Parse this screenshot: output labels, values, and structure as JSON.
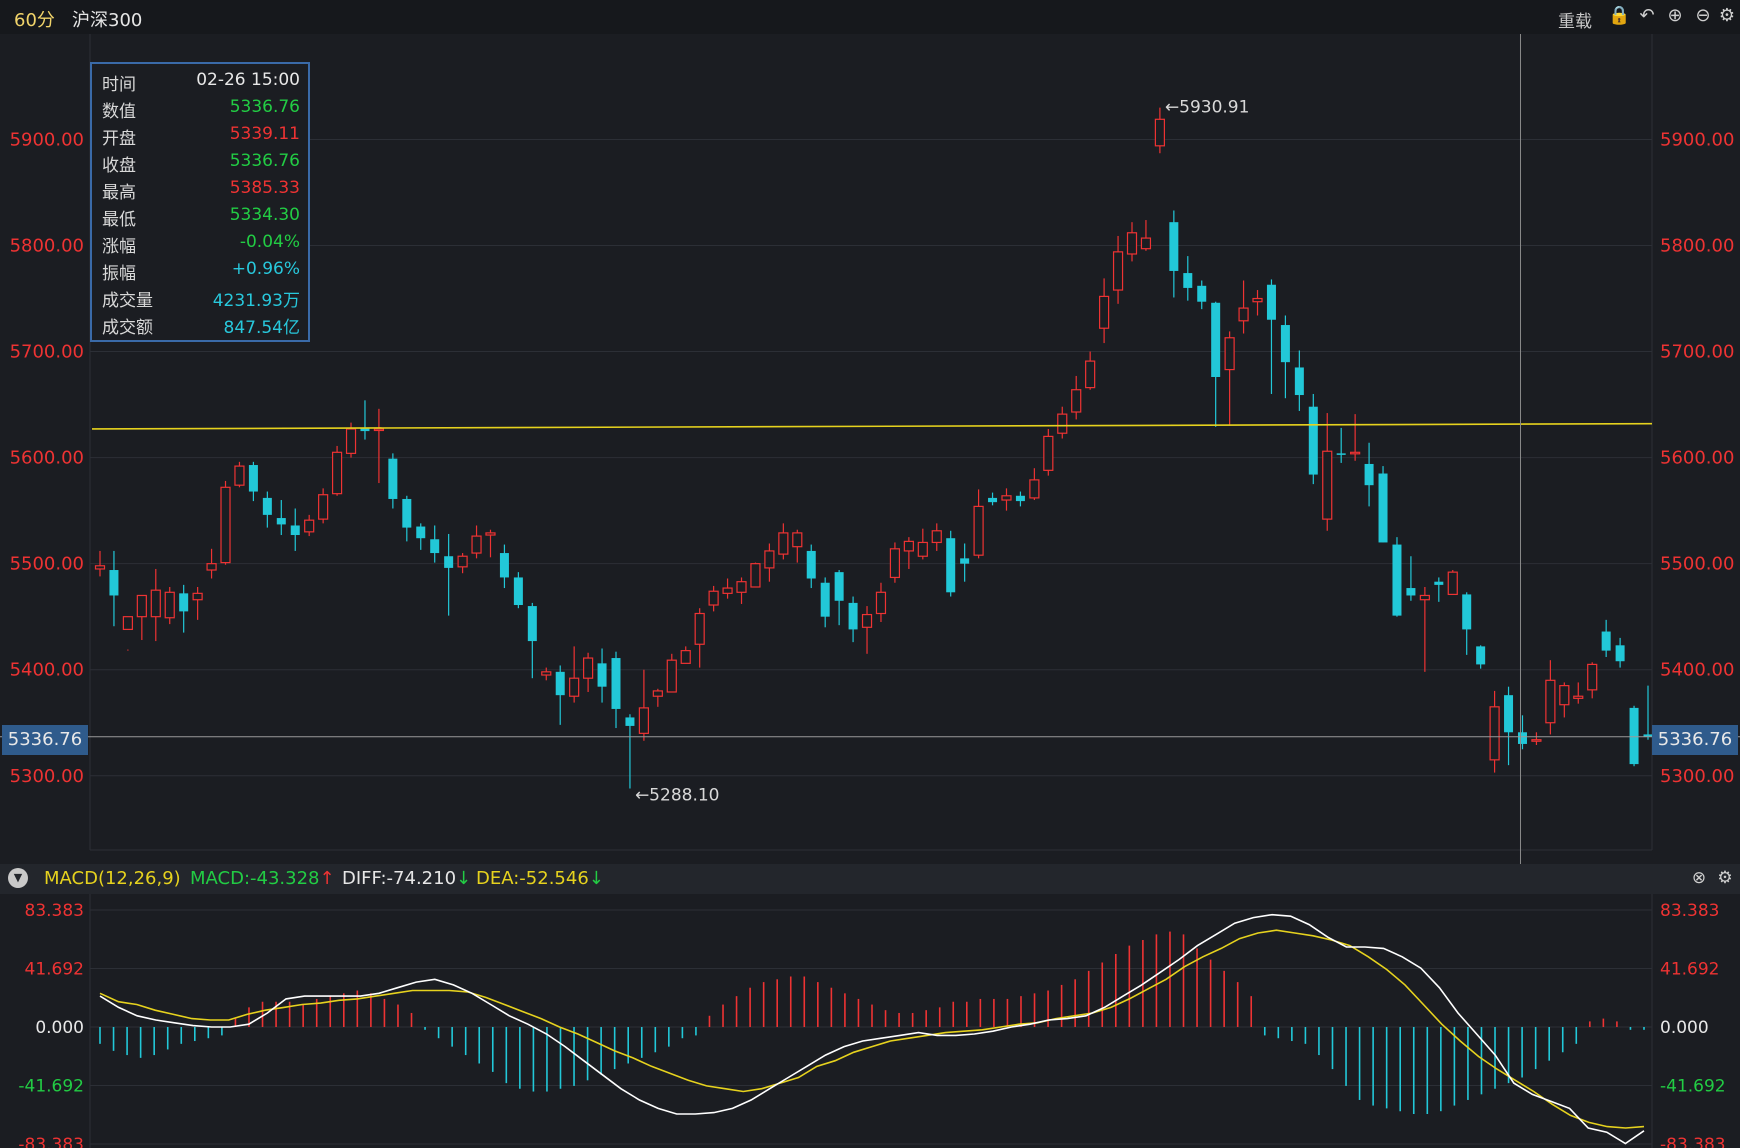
{
  "header": {
    "period": "60分",
    "instrument": "沪深300",
    "reload_label": "重载",
    "icons": [
      "lock-icon",
      "undo-icon",
      "zoom-in-icon",
      "zoom-out-icon",
      "gear-icon"
    ]
  },
  "info_panel": [
    {
      "label": "时间",
      "value": "02-26 15:00",
      "color": "#e8e8e8"
    },
    {
      "label": "数值",
      "value": "5336.76",
      "color": "#22cc44"
    },
    {
      "label": "开盘",
      "value": "5339.11",
      "color": "#ee3333"
    },
    {
      "label": "收盘",
      "value": "5336.76",
      "color": "#22cc44"
    },
    {
      "label": "最高",
      "value": "5385.33",
      "color": "#ee3333"
    },
    {
      "label": "最低",
      "value": "5334.30",
      "color": "#22cc44"
    },
    {
      "label": "涨幅",
      "value": "-0.04%",
      "color": "#22cc44"
    },
    {
      "label": "振幅",
      "value": "+0.96%",
      "color": "#28c8dc"
    },
    {
      "label": "成交量",
      "value": "4231.93万",
      "color": "#28c8dc"
    },
    {
      "label": "成交额",
      "value": "847.54亿",
      "color": "#28c8dc"
    }
  ],
  "macd_header": {
    "params": "MACD(12,26,9)",
    "macd": "MACD:-43.328",
    "diff": "DIFF:-74.210",
    "dea": "DEA:-52.546",
    "macd_arrow": "↑",
    "diff_arrow": "↓",
    "dea_arrow": "↓"
  },
  "colors": {
    "up": "#ee3333",
    "down": "#22c8d8",
    "grid": "#2c2f36",
    "price_axis": "#ee3333",
    "hline": "#e6d21e",
    "diff_line": "#ffffff",
    "dea_line": "#e6d21e"
  },
  "chart_data": [
    {
      "type": "candlestick",
      "yticks": [
        "5900.00",
        "5800.00",
        "5700.00",
        "5600.00",
        "5500.00",
        "5400.00",
        "5300.00"
      ],
      "ylim": [
        5230,
        5990
      ],
      "current_price": "5336.76",
      "high_annotation": "←5930.91",
      "high_value": 5930.91,
      "low_annotation": "←5288.10",
      "low_value": 5288.1,
      "horizontal_line": [
        5627,
        5632
      ],
      "candles": [
        [
          5495,
          5498,
          5512,
          5488
        ],
        [
          5494,
          5470,
          5512,
          5441
        ],
        [
          5438,
          5450,
          5418,
          5419
        ],
        [
          5450,
          5470,
          5470,
          5428
        ],
        [
          5450,
          5475,
          5495,
          5427
        ],
        [
          5449,
          5473,
          5478,
          5443
        ],
        [
          5472,
          5455,
          5480,
          5435
        ],
        [
          5466,
          5472,
          5478,
          5447
        ],
        [
          5494,
          5500,
          5514,
          5486
        ],
        [
          5501,
          5572,
          5578,
          5499
        ],
        [
          5574,
          5592,
          5596,
          5572
        ],
        [
          5593,
          5568,
          5596,
          5559
        ],
        [
          5562,
          5546,
          5568,
          5534
        ],
        [
          5543,
          5537,
          5560,
          5527
        ],
        [
          5536,
          5527,
          5552,
          5512
        ],
        [
          5530,
          5541,
          5546,
          5526
        ],
        [
          5542,
          5565,
          5571,
          5538
        ],
        [
          5566,
          5605,
          5611,
          5564
        ],
        [
          5604,
          5627,
          5633,
          5600
        ],
        [
          5628,
          5625,
          5654,
          5617
        ],
        [
          5626,
          5627,
          5646,
          5576
        ],
        [
          5599,
          5561,
          5604,
          5552
        ],
        [
          5561,
          5534,
          5564,
          5521
        ],
        [
          5535,
          5524,
          5538,
          5513
        ],
        [
          5523,
          5510,
          5536,
          5501
        ],
        [
          5507,
          5496,
          5528,
          5451
        ],
        [
          5497,
          5507,
          5510,
          5491
        ],
        [
          5510,
          5526,
          5536,
          5505
        ],
        [
          5527,
          5529,
          5532,
          5506
        ],
        [
          5510,
          5487,
          5518,
          5477
        ],
        [
          5487,
          5461,
          5492,
          5458
        ],
        [
          5460,
          5427,
          5463,
          5392
        ],
        [
          5395,
          5398,
          5402,
          5390
        ],
        [
          5398,
          5376,
          5404,
          5348
        ],
        [
          5375,
          5392,
          5422,
          5369
        ],
        [
          5392,
          5411,
          5416,
          5379
        ],
        [
          5406,
          5384,
          5420,
          5369
        ],
        [
          5411,
          5363,
          5417,
          5345
        ],
        [
          5355,
          5347,
          5358,
          5288
        ],
        [
          5340,
          5364,
          5400,
          5333
        ],
        [
          5375,
          5380,
          5382,
          5365
        ],
        [
          5379,
          5409,
          5415,
          5379
        ],
        [
          5406,
          5418,
          5422,
          5407
        ],
        [
          5424,
          5453,
          5458,
          5402
        ],
        [
          5461,
          5474,
          5479,
          5455
        ],
        [
          5472,
          5477,
          5486,
          5467
        ],
        [
          5473,
          5483,
          5487,
          5462
        ],
        [
          5478,
          5500,
          5501,
          5478
        ],
        [
          5496,
          5512,
          5519,
          5483
        ],
        [
          5509,
          5529,
          5538,
          5504
        ],
        [
          5516,
          5529,
          5532,
          5501
        ],
        [
          5512,
          5486,
          5518,
          5477
        ],
        [
          5482,
          5450,
          5487,
          5440
        ],
        [
          5492,
          5465,
          5494,
          5442
        ],
        [
          5463,
          5438,
          5469,
          5426
        ],
        [
          5440,
          5452,
          5460,
          5415
        ],
        [
          5453,
          5473,
          5482,
          5445
        ],
        [
          5487,
          5514,
          5520,
          5482
        ],
        [
          5512,
          5521,
          5525,
          5495
        ],
        [
          5507,
          5520,
          5533,
          5504
        ],
        [
          5520,
          5531,
          5538,
          5512
        ],
        [
          5524,
          5473,
          5531,
          5469
        ],
        [
          5505,
          5500,
          5519,
          5483
        ],
        [
          5508,
          5554,
          5570,
          5505
        ],
        [
          5562,
          5558,
          5567,
          5555
        ],
        [
          5560,
          5564,
          5571,
          5550
        ],
        [
          5564,
          5559,
          5568,
          5554
        ],
        [
          5562,
          5579,
          5590,
          5560
        ],
        [
          5588,
          5620,
          5627,
          5583
        ],
        [
          5623,
          5641,
          5648,
          5618
        ],
        [
          5643,
          5664,
          5677,
          5636
        ],
        [
          5666,
          5691,
          5700,
          5664
        ],
        [
          5722,
          5752,
          5769,
          5708
        ],
        [
          5758,
          5794,
          5809,
          5745
        ],
        [
          5792,
          5812,
          5822,
          5785
        ],
        [
          5797,
          5807,
          5824,
          5795
        ],
        [
          5894,
          5919,
          5930,
          5887
        ],
        [
          5822,
          5776,
          5833,
          5751
        ],
        [
          5774,
          5760,
          5790,
          5748
        ],
        [
          5762,
          5747,
          5767,
          5740
        ],
        [
          5746,
          5676,
          5747,
          5629
        ],
        [
          5683,
          5713,
          5719,
          5630
        ],
        [
          5729,
          5741,
          5767,
          5717
        ],
        [
          5747,
          5750,
          5758,
          5734
        ],
        [
          5763,
          5730,
          5768,
          5660
        ],
        [
          5725,
          5690,
          5734,
          5656
        ],
        [
          5685,
          5659,
          5701,
          5644
        ],
        [
          5648,
          5584,
          5660,
          5575
        ],
        [
          5542,
          5606,
          5642,
          5531
        ],
        [
          5604,
          5603,
          5628,
          5595
        ],
        [
          5604,
          5605,
          5641,
          5597
        ],
        [
          5594,
          5574,
          5614,
          5554
        ],
        [
          5585,
          5520,
          5592,
          5520
        ],
        [
          5518,
          5451,
          5525,
          5450
        ],
        [
          5477,
          5470,
          5507,
          5465
        ],
        [
          5466,
          5470,
          5478,
          5398
        ],
        [
          5483,
          5480,
          5487,
          5464
        ],
        [
          5471,
          5492,
          5494,
          5472
        ],
        [
          5471,
          5438,
          5473,
          5414
        ],
        [
          5422,
          5405,
          5423,
          5401
        ],
        [
          5315,
          5365,
          5380,
          5303
        ],
        [
          5376,
          5341,
          5384,
          5310
        ],
        [
          5341,
          5330,
          5357,
          5325
        ],
        [
          5333,
          5334,
          5341,
          5329
        ],
        [
          5350,
          5390,
          5409,
          5339
        ],
        [
          5367,
          5385,
          5388,
          5355
        ],
        [
          5373,
          5375,
          5388,
          5368
        ],
        [
          5381,
          5405,
          5407,
          5373
        ],
        [
          5436,
          5418,
          5447,
          5412
        ],
        [
          5423,
          5408,
          5430,
          5402
        ],
        [
          5364,
          5311,
          5366,
          5309
        ],
        [
          5339,
          5337,
          5385,
          5334
        ]
      ]
    },
    {
      "type": "macd",
      "params": "MACD(12,26,9)",
      "yticks": [
        "83.383",
        "41.692",
        "0.000",
        "-41.692",
        "-83.383"
      ],
      "ylim": [
        -83.383,
        83.383
      ],
      "diff": [
        22,
        14,
        8,
        5,
        3,
        1,
        0,
        0,
        2,
        10,
        20,
        22,
        22,
        22,
        22,
        24,
        28,
        32,
        34,
        30,
        24,
        16,
        8,
        2,
        -5,
        -14,
        -24,
        -34,
        -44,
        -52,
        -58,
        -62,
        -62,
        -61,
        -58,
        -52,
        -44,
        -36,
        -28,
        -20,
        -14,
        -10,
        -8,
        -6,
        -4,
        -6,
        -6,
        -5,
        -3,
        0,
        2,
        5,
        6,
        8,
        14,
        22,
        30,
        39,
        48,
        58,
        66,
        74,
        78,
        80,
        79,
        73,
        64,
        57,
        57,
        56,
        50,
        42,
        28,
        10,
        -5,
        -20,
        -40,
        -48,
        -53,
        -58,
        -72,
        -75,
        -83,
        -74
      ],
      "dea": [
        24,
        18,
        16,
        12,
        9,
        6,
        5,
        5,
        9,
        12,
        14,
        16,
        17,
        19,
        20,
        22,
        24,
        26,
        26,
        26,
        25,
        21,
        16,
        11,
        6,
        0,
        -5,
        -11,
        -17,
        -22,
        -28,
        -33,
        -38,
        -42,
        -44,
        -46,
        -44,
        -40,
        -36,
        -28,
        -24,
        -18,
        -14,
        -10,
        -8,
        -6,
        -4,
        -3,
        -2,
        0,
        2,
        3,
        6,
        8,
        10,
        14,
        20,
        27,
        34,
        43,
        50,
        56,
        63,
        67,
        69,
        67,
        65,
        62,
        58,
        50,
        41,
        30,
        16,
        2,
        -10,
        -21,
        -30,
        -38,
        -46,
        -55,
        -63,
        -68,
        -71,
        -72,
        -71
      ],
      "hist": [
        -12,
        -17,
        -20,
        -22,
        -20,
        -16,
        -12,
        -10,
        -8,
        -6,
        6,
        14,
        18,
        18,
        18,
        16,
        20,
        22,
        24,
        26,
        24,
        20,
        16,
        10,
        -2,
        -8,
        -14,
        -20,
        -26,
        -32,
        -40,
        -44,
        -46,
        -46,
        -44,
        -42,
        -38,
        -34,
        -30,
        -26,
        -22,
        -18,
        -14,
        -8,
        -6,
        8,
        16,
        22,
        28,
        32,
        34,
        36,
        36,
        32,
        28,
        24,
        20,
        16,
        12,
        10,
        10,
        12,
        14,
        18,
        18,
        20,
        20,
        20,
        22,
        24,
        26,
        30,
        34,
        40,
        46,
        52,
        58,
        62,
        66,
        68,
        66,
        56,
        48,
        40,
        32,
        22,
        -6,
        -8,
        -10,
        -12,
        -20,
        -30,
        -42,
        -52,
        -56,
        -58,
        -60,
        -62,
        -62,
        -60,
        -56,
        -52,
        -48,
        -44,
        -40,
        -36,
        -30,
        -24,
        -18,
        -12,
        4,
        6,
        4,
        -2,
        -2
      ]
    }
  ]
}
